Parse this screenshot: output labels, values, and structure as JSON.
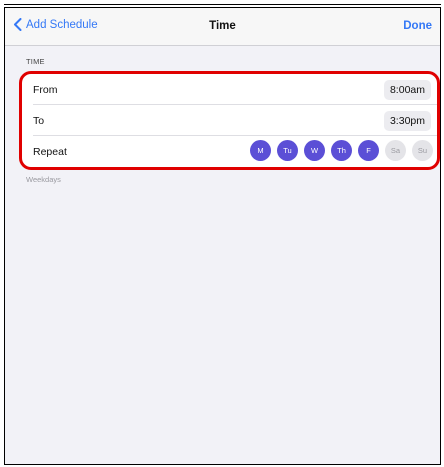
{
  "nav": {
    "back_label": "Add Schedule",
    "title": "Time",
    "done_label": "Done"
  },
  "section": {
    "header": "TIME",
    "footer": "Weekdays"
  },
  "rows": {
    "from": {
      "label": "From",
      "value": "8:00am"
    },
    "to": {
      "label": "To",
      "value": "3:30pm"
    },
    "repeat": {
      "label": "Repeat"
    }
  },
  "days": [
    {
      "label": "M",
      "selected": true
    },
    {
      "label": "Tu",
      "selected": true
    },
    {
      "label": "W",
      "selected": true
    },
    {
      "label": "Th",
      "selected": true
    },
    {
      "label": "F",
      "selected": true
    },
    {
      "label": "Sa",
      "selected": false
    },
    {
      "label": "Su",
      "selected": false
    }
  ],
  "colors": {
    "accent": "#3478f6",
    "day_selected": "#5b4fd6",
    "highlight_border": "#e00000"
  }
}
